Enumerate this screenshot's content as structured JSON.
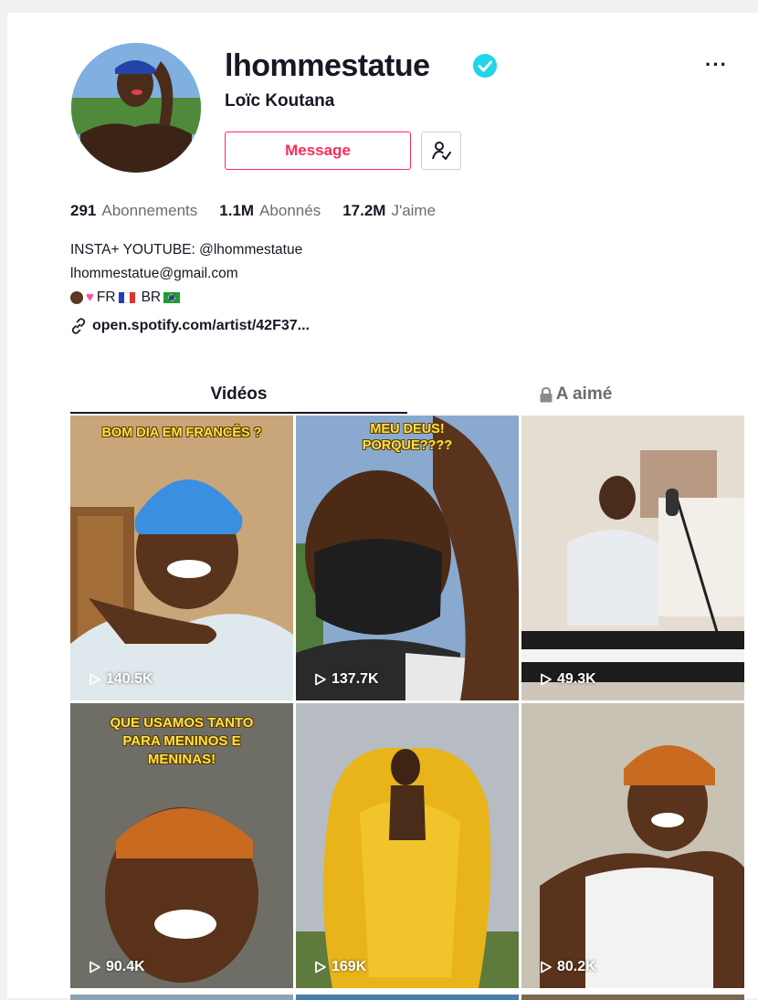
{
  "profile": {
    "username": "lhommestatue",
    "display_name": "Loïc Koutana",
    "message_label": "Message",
    "more_label": "···"
  },
  "stats": [
    {
      "value": "291",
      "label": "Abonnements"
    },
    {
      "value": "1.1M",
      "label": "Abonnés"
    },
    {
      "value": "17.2M",
      "label": "J'aime"
    }
  ],
  "bio": {
    "line1": "INSTA+ YOUTUBE: @lhommestatue",
    "line2": "lhommestatue@gmail.com",
    "line3_text": "FR",
    "line3_text2": "BR",
    "link": "open.spotify.com/artist/42F37..."
  },
  "tabs": {
    "videos": "Vidéos",
    "liked": "A aimé"
  },
  "videos": [
    {
      "views": "140.5K",
      "caption": "BOM DIA EM FRANCÊS ?"
    },
    {
      "views": "137.7K",
      "caption": "MEU DEUS! PORQUE????"
    },
    {
      "views": "49.3K",
      "caption": ""
    },
    {
      "views": "90.4K",
      "caption": "QUE USAMOS TANTO PARA MENINOS E MENINAS!"
    },
    {
      "views": "169K",
      "caption": ""
    },
    {
      "views": "80.2K",
      "caption": ""
    }
  ],
  "colors": {
    "accent": "#fe2c55",
    "verified": "#20d5ec"
  }
}
